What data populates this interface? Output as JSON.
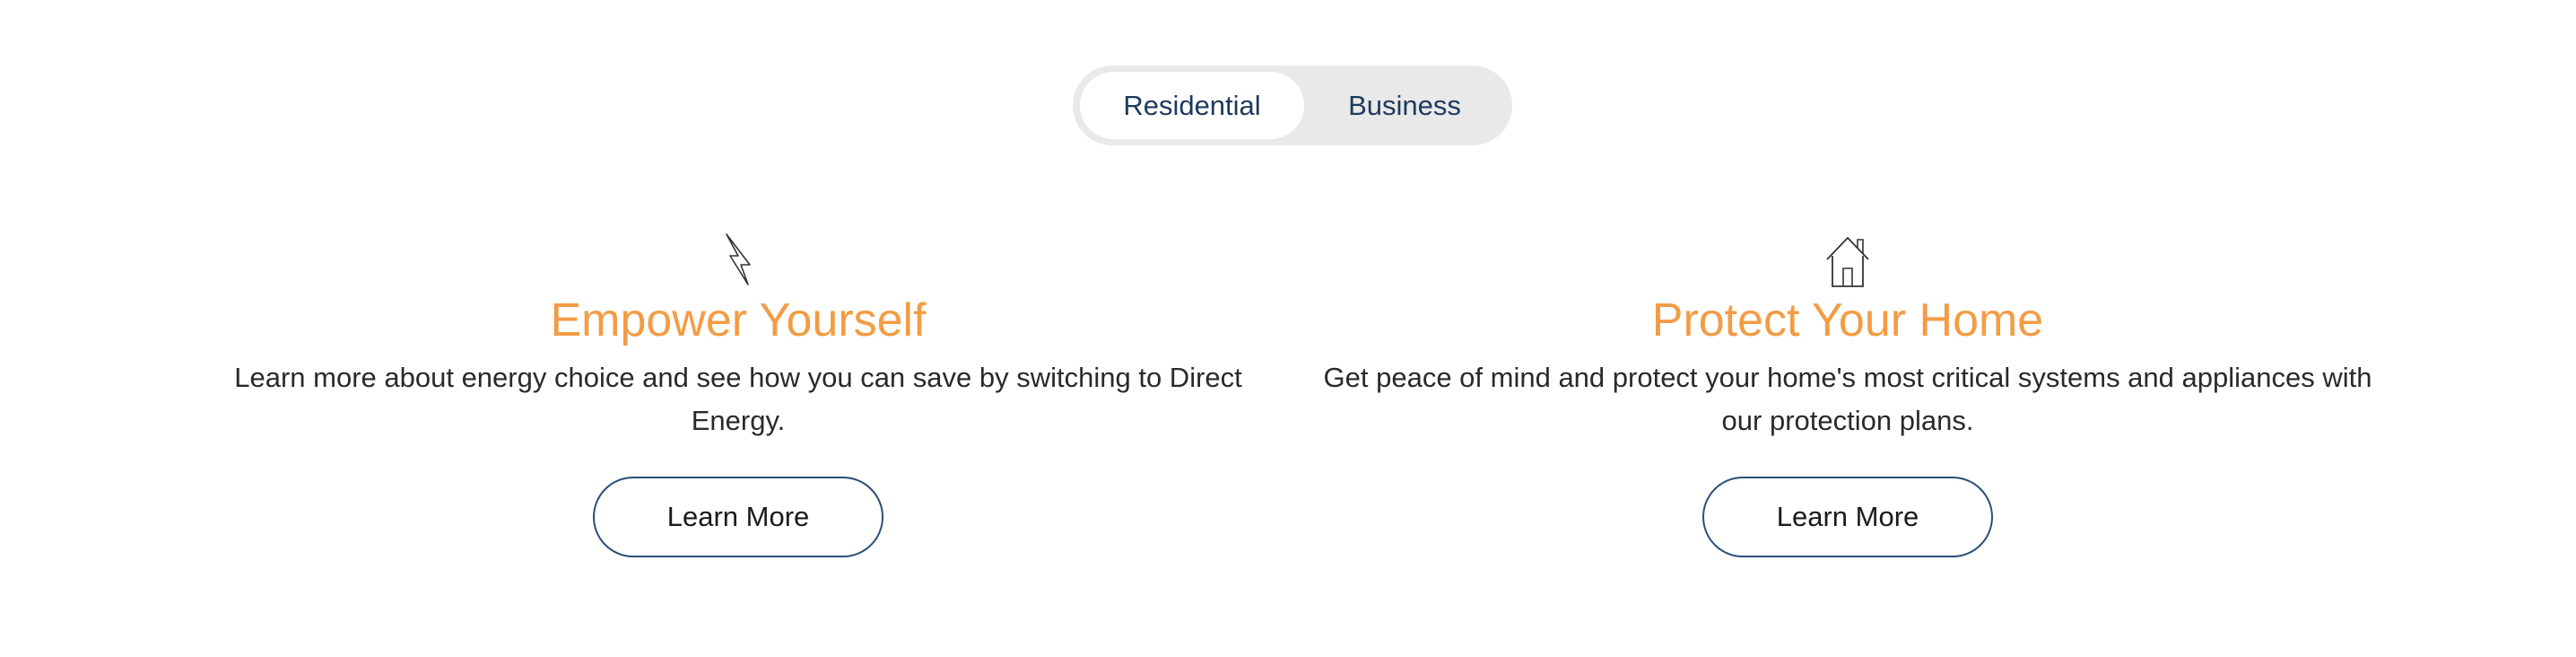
{
  "toggle": {
    "options": [
      {
        "label": "Residential",
        "selected": true
      },
      {
        "label": "Business",
        "selected": false
      }
    ]
  },
  "cards": [
    {
      "icon": "lightning-bolt-icon",
      "title": "Empower Yourself",
      "text": "Learn more about energy choice and see how you can save by switching to Direct Energy.",
      "button_label": "Learn More"
    },
    {
      "icon": "house-icon",
      "title": "Protect Your Home",
      "text": "Get peace of mind and protect your home's most critical systems and appliances with our protection plans.",
      "button_label": "Learn More"
    }
  ],
  "colors": {
    "accent_title": "#f39c45",
    "button_border": "#2a4f78",
    "toggle_text": "#1c3a5e",
    "toggle_bg": "#e9e9e9"
  }
}
